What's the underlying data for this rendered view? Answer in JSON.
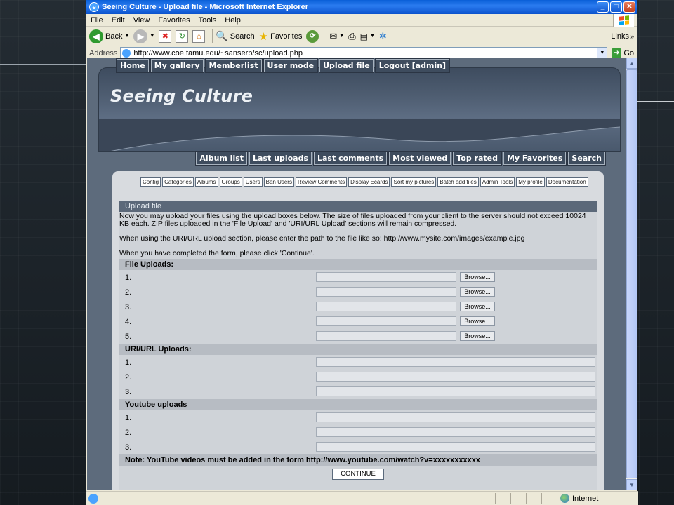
{
  "window": {
    "title": "Seeing Culture - Upload file - Microsoft Internet Explorer",
    "menu": [
      "File",
      "Edit",
      "View",
      "Favorites",
      "Tools",
      "Help"
    ],
    "toolbar": {
      "back": "Back",
      "search": "Search",
      "favorites": "Favorites",
      "links": "Links"
    },
    "address_label": "Address",
    "url": "http://www.coe.tamu.edu/~sanserb/sc/upload.php",
    "go": "Go",
    "status_zone": "Internet",
    "colors": {
      "title_bar": "#0a5fd8",
      "chrome": "#ece9d8"
    }
  },
  "site": {
    "top_nav": [
      "Home",
      "My gallery",
      "Memberlist",
      "User mode",
      "Upload file",
      "Logout [admin]"
    ],
    "title": "Seeing Culture",
    "sub_nav": [
      "Album list",
      "Last uploads",
      "Last comments",
      "Most viewed",
      "Top rated",
      "My Favorites",
      "Search"
    ],
    "admin_menu": [
      "Config",
      "Categories",
      "Albums",
      "Groups",
      "Users",
      "Ban Users",
      "Review Comments",
      "Display Ecards",
      "Sort my pictures",
      "Batch add files",
      "Admin Tools",
      "My profile",
      "Documentation"
    ],
    "colors": {
      "header": "#4f5e72",
      "panel": "#d8dbdf",
      "form_heading": "#5b6879"
    }
  },
  "form": {
    "heading": "Upload file",
    "intro1": "Now you may upload your files using the upload boxes below. The size of files uploaded from your client to the server should not exceed 10024 KB each. ZIP files uploaded in the 'File Upload' and 'URI/URL Upload' sections will remain compressed.",
    "intro2": "When using the URI/URL upload section, please enter the path to the file like so: http://www.mysite.com/images/example.jpg",
    "intro3": "When you have completed the form, please click 'Continue'.",
    "file_section": "File Uploads:",
    "file_rows": [
      "1.",
      "2.",
      "3.",
      "4.",
      "5."
    ],
    "browse_label": "Browse...",
    "url_section": "URI/URL Uploads:",
    "url_rows": [
      "1.",
      "2.",
      "3."
    ],
    "youtube_section": "Youtube uploads",
    "youtube_rows": [
      "1.",
      "2.",
      "3."
    ],
    "note": "Note: YouTube videos must be added in the form http://www.youtube.com/watch?v=xxxxxxxxxxx",
    "continue": "CONTINUE"
  }
}
